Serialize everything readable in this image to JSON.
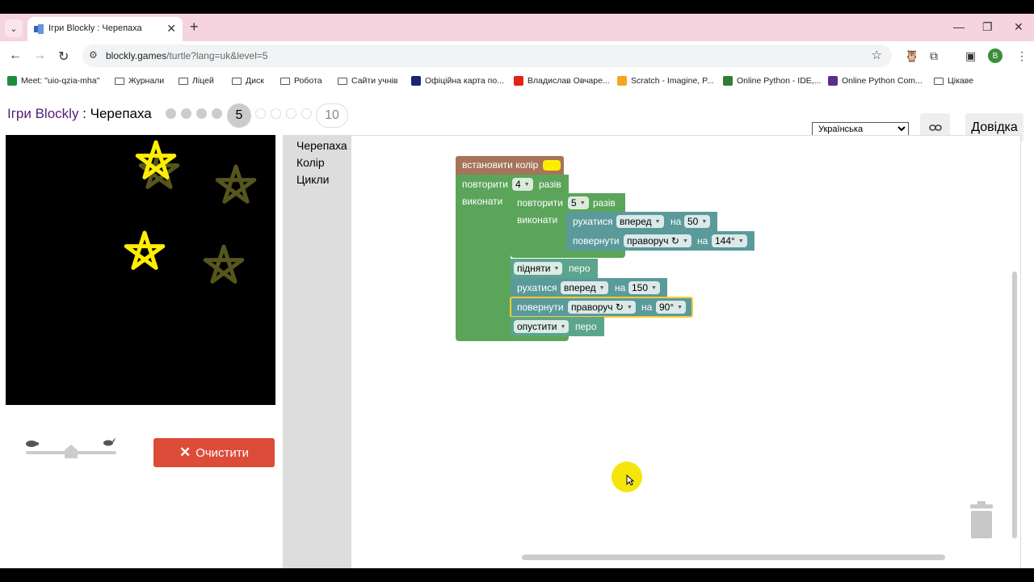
{
  "browser": {
    "tab_title": "Ігри Blockly : Черепаха",
    "url_host": "blockly.games",
    "url_path": "/turtle?lang=uk&level=5",
    "avatar_letter": "B"
  },
  "bookmarks": [
    {
      "label": "Meet: \"uio-qzia-mha\"",
      "icon": "meet-icon",
      "color": "#1e8e3e"
    },
    {
      "label": "Журнали",
      "icon": "folder-icon"
    },
    {
      "label": "Ліцей",
      "icon": "folder-icon"
    },
    {
      "label": "Диск",
      "icon": "folder-icon"
    },
    {
      "label": "Робота",
      "icon": "folder-icon"
    },
    {
      "label": "Сайти учнів",
      "icon": "folder-icon"
    },
    {
      "label": "Офіційна карта по...",
      "icon": "map-icon",
      "color": "#1a237e"
    },
    {
      "label": "Владислав Овчаре...",
      "icon": "youtube-icon",
      "color": "#e62117"
    },
    {
      "label": "Scratch - Imagine, P...",
      "icon": "scratch-icon",
      "color": "#f5a623"
    },
    {
      "label": "Online Python - IDE,...",
      "icon": "python-shield-icon",
      "color": "#2e7d32"
    },
    {
      "label": "Online Python Com...",
      "icon": "python-bolt-icon",
      "color": "#5c2d91"
    },
    {
      "label": "Цікаве",
      "icon": "folder-icon"
    }
  ],
  "header": {
    "games_label": "Ігри Blockly",
    "separator": " : ",
    "app_label": "Черепаха",
    "current_level": "5",
    "last_level": "10",
    "language": "Українська",
    "help_label": "Довідка"
  },
  "controls": {
    "reset_label": "Очистити",
    "speed_fraction": 0.5
  },
  "toolbox": {
    "categories": [
      "Черепаха",
      "Колір",
      "Цикли"
    ]
  },
  "blocks": {
    "set_colour": {
      "label": "встановити колір",
      "colour": "#ffee00"
    },
    "repeat_outer": {
      "label": "повторити",
      "count": "4",
      "suffix": "разів",
      "do_label": "виконати"
    },
    "repeat_inner": {
      "label": "повторити",
      "count": "5",
      "suffix": "разів",
      "do_label": "виконати"
    },
    "move1": {
      "label": "рухатися",
      "dir": "вперед",
      "on": "на",
      "value": "50"
    },
    "turn1": {
      "label": "повернути",
      "dir": "праворуч ↻",
      "on": "на",
      "value": "144°"
    },
    "pen_up": {
      "state": "підняти",
      "label": "перо"
    },
    "move2": {
      "label": "рухатися",
      "dir": "вперед",
      "on": "на",
      "value": "150"
    },
    "turn2": {
      "label": "повернути",
      "dir": "праворуч ↻",
      "on": "на",
      "value": "90°"
    },
    "pen_down": {
      "state": "опустити",
      "label": "перо"
    }
  },
  "colors": {
    "turtle_block": "#5b9a9a",
    "loop_block": "#5ba55b",
    "colour_block": "#a5745b",
    "reset": "#dd4b39",
    "star_bright": "#ffee00",
    "star_faint": "#55551e"
  }
}
